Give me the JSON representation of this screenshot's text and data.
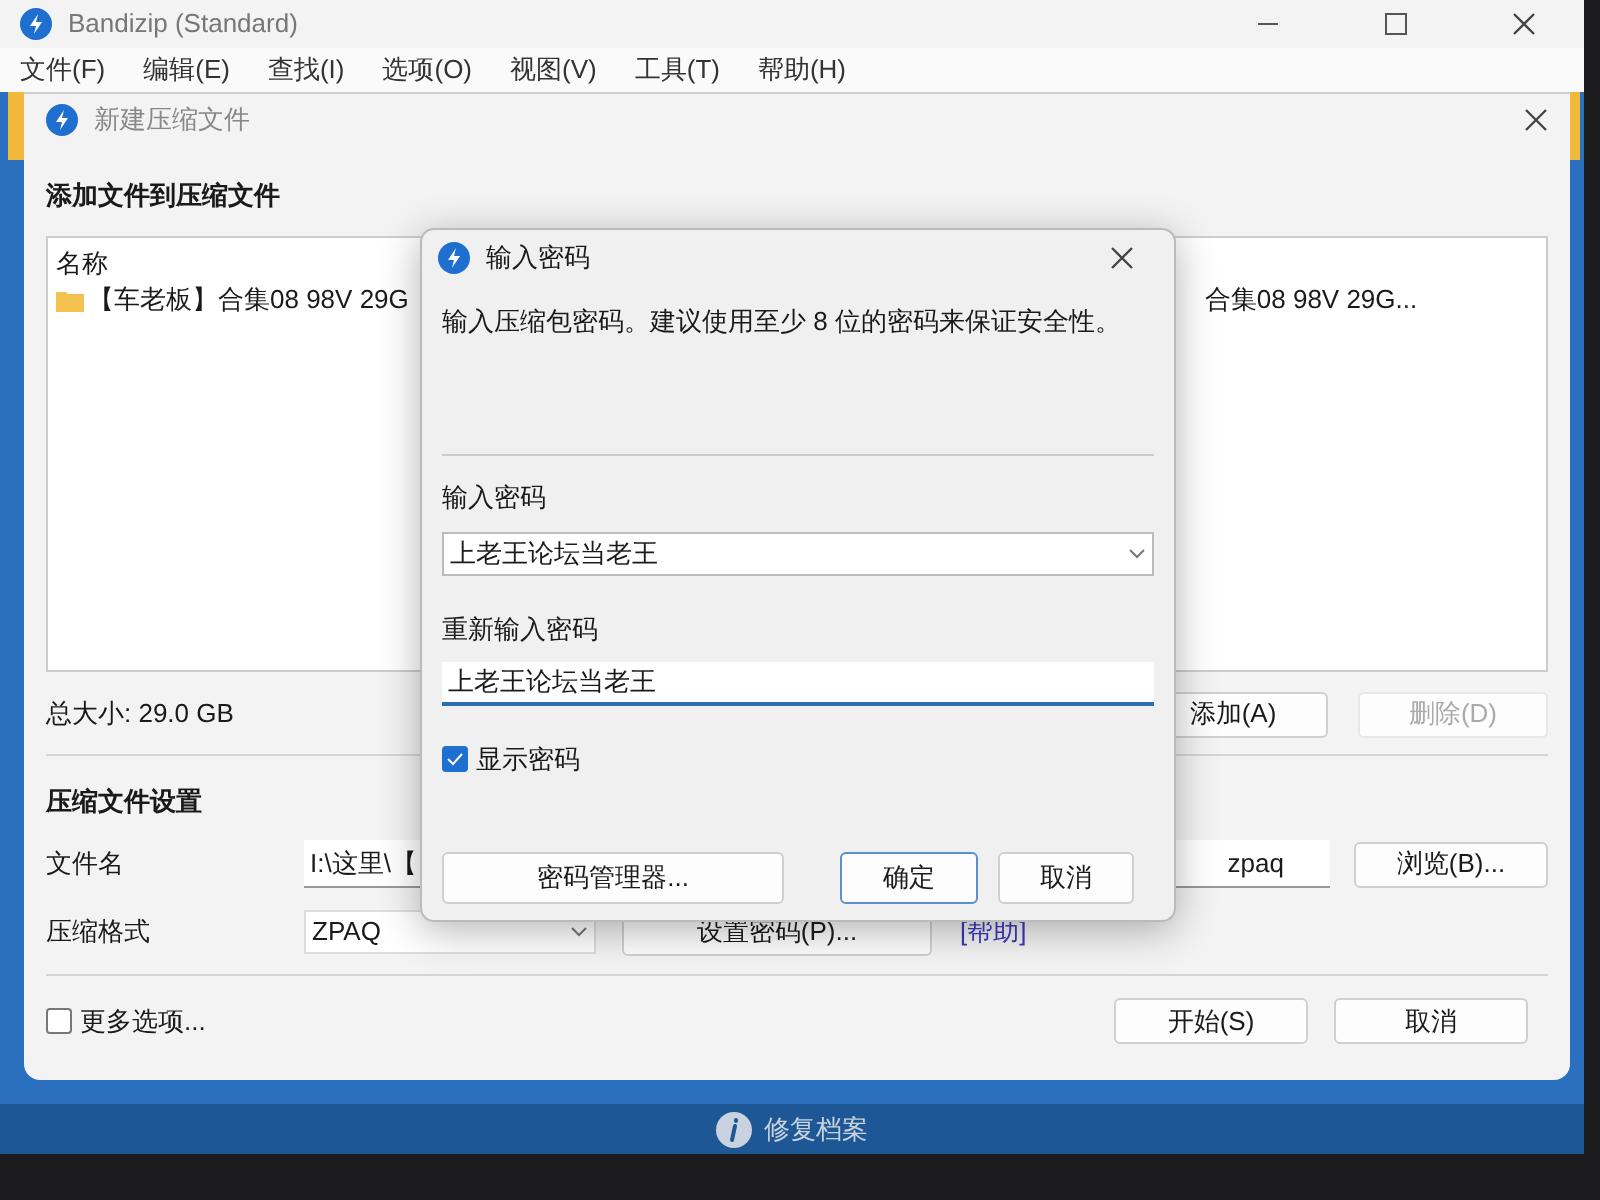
{
  "window": {
    "title": "Bandizip (Standard)"
  },
  "menu": [
    "文件(F)",
    "编辑(E)",
    "查找(I)",
    "选项(O)",
    "视图(V)",
    "工具(T)",
    "帮助(H)"
  ],
  "new_archive": {
    "title": "新建压缩文件",
    "heading": "添加文件到压缩文件",
    "list_header": "名称",
    "row": {
      "column_1": "【车老板】合集08 98V 29G",
      "column_2": "合集08 98V 29G..."
    },
    "total_size": "总大小: 29.0 GB",
    "buttons": [
      {
        "label": "添加(A)",
        "disabled": false
      },
      {
        "label": "删除(D)",
        "disabled": true
      }
    ],
    "settings_heading": "压缩文件设置",
    "filename": {
      "label": "文件名",
      "value_start": "I:\\这里\\【",
      "value_end": "zpaq",
      "browse": "浏览(B)..."
    },
    "format": {
      "label": "压缩格式",
      "value": "ZPAQ",
      "set_password": "设置密码(P)...",
      "help": "[帮助]"
    },
    "more_options": {
      "label": "更多选项...",
      "checked": false
    },
    "start": "开始(S)",
    "cancel": "取消"
  },
  "status_bar": {
    "label": "修复档案"
  },
  "password_dialog": {
    "title": "输入密码",
    "message": "输入压缩包密码。建议使用至少 8 位的密码来保证安全性。",
    "password_label": "输入密码",
    "password": "上老王论坛当老王",
    "repeat_label": "重新输入密码",
    "repeat": "上老王论坛当老王",
    "show_password": {
      "label": "显示密码",
      "checked": true
    },
    "buttons": [
      {
        "label": "密码管理器...",
        "kind": "wide",
        "focused": false
      },
      {
        "label": "确定",
        "kind": "normal",
        "focused": true
      },
      {
        "label": "取消",
        "kind": "normal",
        "focused": false
      }
    ]
  }
}
